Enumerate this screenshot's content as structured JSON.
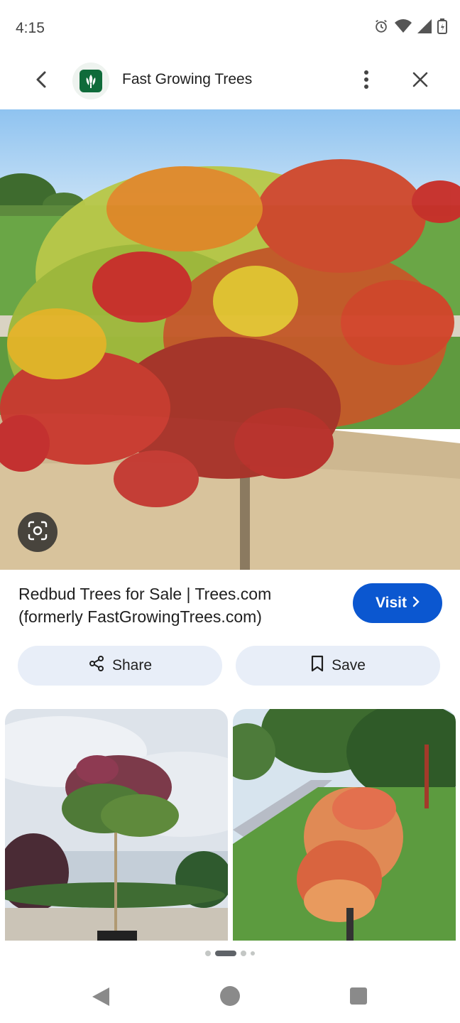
{
  "status_bar": {
    "time": "4:15",
    "icons": [
      "alarm-icon",
      "wifi-icon",
      "signal-icon",
      "battery-icon"
    ]
  },
  "header": {
    "site_name": "Fast Growing Trees",
    "logo_icon": "tree-logo-icon",
    "back_icon": "back-arrow-icon",
    "more_icon": "more-vertical-icon",
    "close_icon": "close-icon"
  },
  "main_image": {
    "lens_icon": "google-lens-icon"
  },
  "result": {
    "title": "Redbud Trees for Sale | Trees.com (formerly FastGrowingTrees.com)",
    "visit_label": "Visit",
    "visit_color": "#0b57d0"
  },
  "actions": {
    "share_label": "Share",
    "save_label": "Save",
    "button_bg": "#e8eef8"
  },
  "related": {
    "items": [
      "redbud-tree-sky",
      "redbud-tree-roadside"
    ]
  },
  "pager": {
    "active_index": 1,
    "count": 4
  },
  "nav": {
    "buttons": [
      "back",
      "home",
      "recents"
    ]
  }
}
